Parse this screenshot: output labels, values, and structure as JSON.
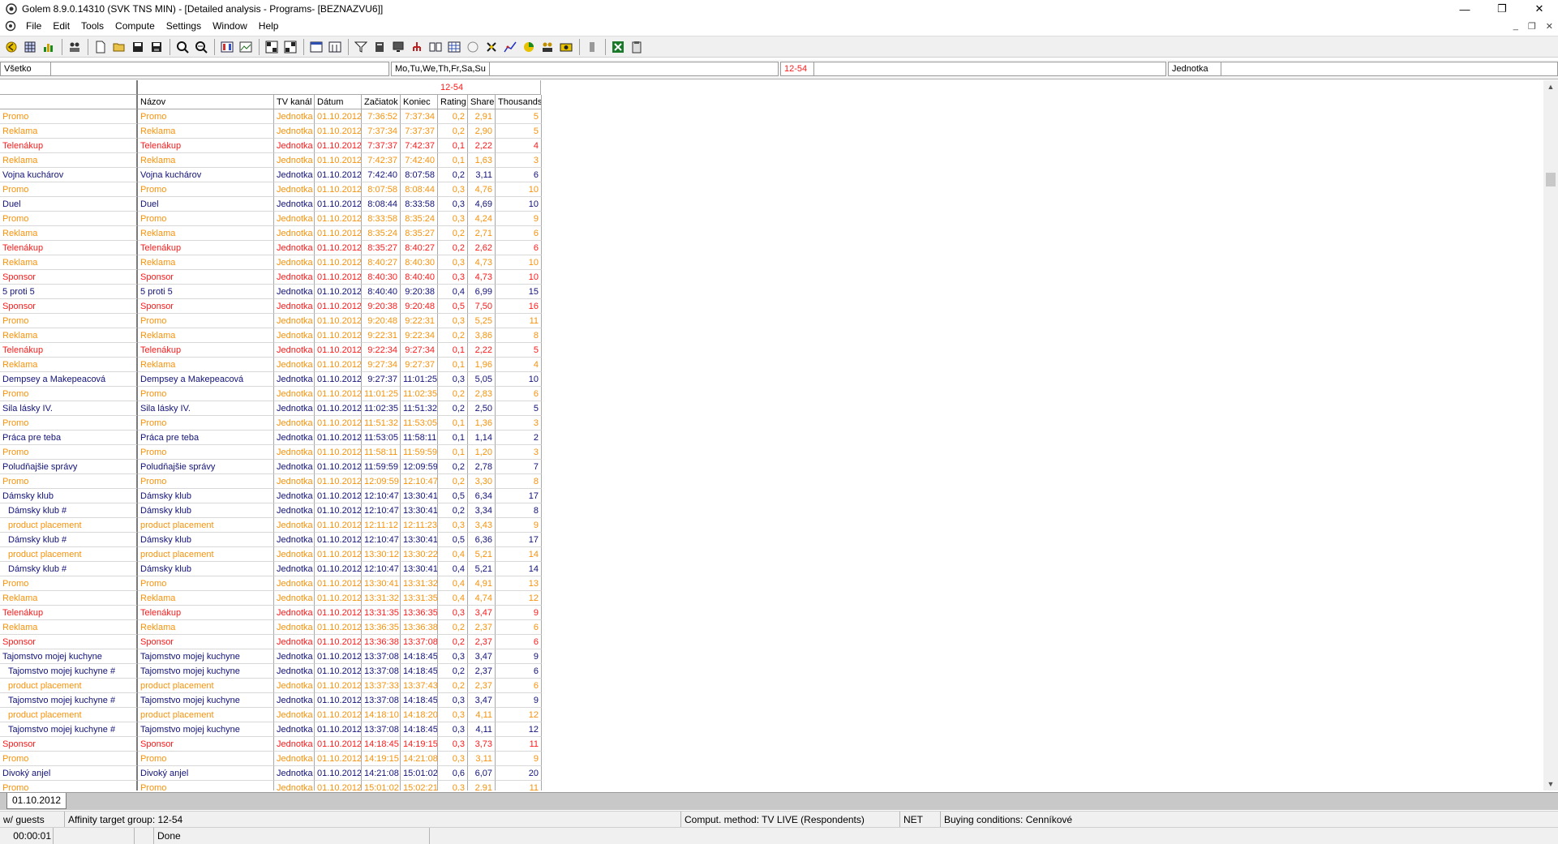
{
  "window": {
    "title": "Golem 8.9.0.14310 (SVK TNS MIN) - [Detailed analysis - Programs- [BEZNAZVU6]]",
    "minimize": "—",
    "restore": "❐",
    "close": "✕"
  },
  "menu": [
    "File",
    "Edit",
    "Tools",
    "Compute",
    "Settings",
    "Window",
    "Help"
  ],
  "mdi_controls": {
    "minimize": "_",
    "restore": "❐",
    "close": "✕"
  },
  "filterbar": {
    "f1": "Všetko",
    "f2": "Mo,Tu,We,Th,Fr,Sa,Su",
    "f3": "12-54",
    "f4": "Jednotka"
  },
  "table": {
    "target_group": "12-54",
    "headers": {
      "name": "Názov",
      "channel": "TV kanál",
      "date": "Dátum",
      "start": "Začiatok",
      "end": "Koniec",
      "rating": "Rating",
      "share": "Share",
      "thousands": "Thousands"
    },
    "rows": [
      {
        "first": "Promo",
        "name": "Promo",
        "ch": "Jednotka",
        "date": "01.10.2012",
        "start": "7:36:52",
        "end": "7:37:34",
        "rating": "0,2",
        "share": "2,91",
        "th": "5",
        "color": "orange",
        "indent": false
      },
      {
        "first": "Reklama",
        "name": "Reklama",
        "ch": "Jednotka",
        "date": "01.10.2012",
        "start": "7:37:34",
        "end": "7:37:37",
        "rating": "0,2",
        "share": "2,90",
        "th": "5",
        "color": "orange",
        "indent": false
      },
      {
        "first": "Telenákup",
        "name": "Telenákup",
        "ch": "Jednotka",
        "date": "01.10.2012",
        "start": "7:37:37",
        "end": "7:42:37",
        "rating": "0,1",
        "share": "2,22",
        "th": "4",
        "color": "red",
        "indent": false
      },
      {
        "first": "Reklama",
        "name": "Reklama",
        "ch": "Jednotka",
        "date": "01.10.2012",
        "start": "7:42:37",
        "end": "7:42:40",
        "rating": "0,1",
        "share": "1,63",
        "th": "3",
        "color": "orange",
        "indent": false
      },
      {
        "first": "Vojna kuchárov",
        "name": "Vojna kuchárov",
        "ch": "Jednotka",
        "date": "01.10.2012",
        "start": "7:42:40",
        "end": "8:07:58",
        "rating": "0,2",
        "share": "3,11",
        "th": "6",
        "color": "navy",
        "indent": false
      },
      {
        "first": "Promo",
        "name": "Promo",
        "ch": "Jednotka",
        "date": "01.10.2012",
        "start": "8:07:58",
        "end": "8:08:44",
        "rating": "0,3",
        "share": "4,76",
        "th": "10",
        "color": "orange",
        "indent": false
      },
      {
        "first": "Duel",
        "name": "Duel",
        "ch": "Jednotka",
        "date": "01.10.2012",
        "start": "8:08:44",
        "end": "8:33:58",
        "rating": "0,3",
        "share": "4,69",
        "th": "10",
        "color": "navy",
        "indent": false
      },
      {
        "first": "Promo",
        "name": "Promo",
        "ch": "Jednotka",
        "date": "01.10.2012",
        "start": "8:33:58",
        "end": "8:35:24",
        "rating": "0,3",
        "share": "4,24",
        "th": "9",
        "color": "orange",
        "indent": false
      },
      {
        "first": "Reklama",
        "name": "Reklama",
        "ch": "Jednotka",
        "date": "01.10.2012",
        "start": "8:35:24",
        "end": "8:35:27",
        "rating": "0,2",
        "share": "2,71",
        "th": "6",
        "color": "orange",
        "indent": false
      },
      {
        "first": "Telenákup",
        "name": "Telenákup",
        "ch": "Jednotka",
        "date": "01.10.2012",
        "start": "8:35:27",
        "end": "8:40:27",
        "rating": "0,2",
        "share": "2,62",
        "th": "6",
        "color": "red",
        "indent": false
      },
      {
        "first": "Reklama",
        "name": "Reklama",
        "ch": "Jednotka",
        "date": "01.10.2012",
        "start": "8:40:27",
        "end": "8:40:30",
        "rating": "0,3",
        "share": "4,73",
        "th": "10",
        "color": "orange",
        "indent": false
      },
      {
        "first": "Sponsor",
        "name": "Sponsor",
        "ch": "Jednotka",
        "date": "01.10.2012",
        "start": "8:40:30",
        "end": "8:40:40",
        "rating": "0,3",
        "share": "4,73",
        "th": "10",
        "color": "red",
        "indent": false
      },
      {
        "first": "5 proti 5",
        "name": "5 proti 5",
        "ch": "Jednotka",
        "date": "01.10.2012",
        "start": "8:40:40",
        "end": "9:20:38",
        "rating": "0,4",
        "share": "6,99",
        "th": "15",
        "color": "navy",
        "indent": false
      },
      {
        "first": "Sponsor",
        "name": "Sponsor",
        "ch": "Jednotka",
        "date": "01.10.2012",
        "start": "9:20:38",
        "end": "9:20:48",
        "rating": "0,5",
        "share": "7,50",
        "th": "16",
        "color": "red",
        "indent": false
      },
      {
        "first": "Promo",
        "name": "Promo",
        "ch": "Jednotka",
        "date": "01.10.2012",
        "start": "9:20:48",
        "end": "9:22:31",
        "rating": "0,3",
        "share": "5,25",
        "th": "11",
        "color": "orange",
        "indent": false
      },
      {
        "first": "Reklama",
        "name": "Reklama",
        "ch": "Jednotka",
        "date": "01.10.2012",
        "start": "9:22:31",
        "end": "9:22:34",
        "rating": "0,2",
        "share": "3,86",
        "th": "8",
        "color": "orange",
        "indent": false
      },
      {
        "first": "Telenákup",
        "name": "Telenákup",
        "ch": "Jednotka",
        "date": "01.10.2012",
        "start": "9:22:34",
        "end": "9:27:34",
        "rating": "0,1",
        "share": "2,22",
        "th": "5",
        "color": "red",
        "indent": false
      },
      {
        "first": "Reklama",
        "name": "Reklama",
        "ch": "Jednotka",
        "date": "01.10.2012",
        "start": "9:27:34",
        "end": "9:27:37",
        "rating": "0,1",
        "share": "1,96",
        "th": "4",
        "color": "orange",
        "indent": false
      },
      {
        "first": "Dempsey a Makepeacová",
        "name": "Dempsey a Makepeacová",
        "ch": "Jednotka",
        "date": "01.10.2012",
        "start": "9:27:37",
        "end": "11:01:25",
        "rating": "0,3",
        "share": "5,05",
        "th": "10",
        "color": "navy",
        "indent": false
      },
      {
        "first": "Promo",
        "name": "Promo",
        "ch": "Jednotka",
        "date": "01.10.2012",
        "start": "11:01:25",
        "end": "11:02:35",
        "rating": "0,2",
        "share": "2,83",
        "th": "6",
        "color": "orange",
        "indent": false
      },
      {
        "first": "Sila lásky IV.",
        "name": "Sila lásky IV.",
        "ch": "Jednotka",
        "date": "01.10.2012",
        "start": "11:02:35",
        "end": "11:51:32",
        "rating": "0,2",
        "share": "2,50",
        "th": "5",
        "color": "navy",
        "indent": false
      },
      {
        "first": "Promo",
        "name": "Promo",
        "ch": "Jednotka",
        "date": "01.10.2012",
        "start": "11:51:32",
        "end": "11:53:05",
        "rating": "0,1",
        "share": "1,36",
        "th": "3",
        "color": "orange",
        "indent": false
      },
      {
        "first": "Práca pre teba",
        "name": "Práca pre teba",
        "ch": "Jednotka",
        "date": "01.10.2012",
        "start": "11:53:05",
        "end": "11:58:11",
        "rating": "0,1",
        "share": "1,14",
        "th": "2",
        "color": "navy",
        "indent": false
      },
      {
        "first": "Promo",
        "name": "Promo",
        "ch": "Jednotka",
        "date": "01.10.2012",
        "start": "11:58:11",
        "end": "11:59:59",
        "rating": "0,1",
        "share": "1,20",
        "th": "3",
        "color": "orange",
        "indent": false
      },
      {
        "first": "Poludňajšie správy",
        "name": "Poludňajšie správy",
        "ch": "Jednotka",
        "date": "01.10.2012",
        "start": "11:59:59",
        "end": "12:09:59",
        "rating": "0,2",
        "share": "2,78",
        "th": "7",
        "color": "navy",
        "indent": false
      },
      {
        "first": "Promo",
        "name": "Promo",
        "ch": "Jednotka",
        "date": "01.10.2012",
        "start": "12:09:59",
        "end": "12:10:47",
        "rating": "0,2",
        "share": "3,30",
        "th": "8",
        "color": "orange",
        "indent": false
      },
      {
        "first": "Dámsky klub",
        "name": "Dámsky klub",
        "ch": "Jednotka",
        "date": "01.10.2012",
        "start": "12:10:47",
        "end": "13:30:41",
        "rating": "0,5",
        "share": "6,34",
        "th": "17",
        "color": "navy",
        "indent": false
      },
      {
        "first": "Dámsky klub #",
        "name": "Dámsky klub",
        "ch": "Jednotka",
        "date": "01.10.2012",
        "start": "12:10:47",
        "end": "13:30:41",
        "rating": "0,2",
        "share": "3,34",
        "th": "8",
        "color": "navy",
        "indent": true
      },
      {
        "first": "product placement",
        "name": "product placement",
        "ch": "Jednotka",
        "date": "01.10.2012",
        "start": "12:11:12",
        "end": "12:11:23",
        "rating": "0,3",
        "share": "3,43",
        "th": "9",
        "color": "orange",
        "indent": true
      },
      {
        "first": "Dámsky klub #",
        "name": "Dámsky klub",
        "ch": "Jednotka",
        "date": "01.10.2012",
        "start": "12:10:47",
        "end": "13:30:41",
        "rating": "0,5",
        "share": "6,36",
        "th": "17",
        "color": "navy",
        "indent": true
      },
      {
        "first": "product placement",
        "name": "product placement",
        "ch": "Jednotka",
        "date": "01.10.2012",
        "start": "13:30:12",
        "end": "13:30:22",
        "rating": "0,4",
        "share": "5,21",
        "th": "14",
        "color": "orange",
        "indent": true
      },
      {
        "first": "Dámsky klub #",
        "name": "Dámsky klub",
        "ch": "Jednotka",
        "date": "01.10.2012",
        "start": "12:10:47",
        "end": "13:30:41",
        "rating": "0,4",
        "share": "5,21",
        "th": "14",
        "color": "navy",
        "indent": true
      },
      {
        "first": "Promo",
        "name": "Promo",
        "ch": "Jednotka",
        "date": "01.10.2012",
        "start": "13:30:41",
        "end": "13:31:32",
        "rating": "0,4",
        "share": "4,91",
        "th": "13",
        "color": "orange",
        "indent": false
      },
      {
        "first": "Reklama",
        "name": "Reklama",
        "ch": "Jednotka",
        "date": "01.10.2012",
        "start": "13:31:32",
        "end": "13:31:35",
        "rating": "0,4",
        "share": "4,74",
        "th": "12",
        "color": "orange",
        "indent": false
      },
      {
        "first": "Telenákup",
        "name": "Telenákup",
        "ch": "Jednotka",
        "date": "01.10.2012",
        "start": "13:31:35",
        "end": "13:36:35",
        "rating": "0,3",
        "share": "3,47",
        "th": "9",
        "color": "red",
        "indent": false
      },
      {
        "first": "Reklama",
        "name": "Reklama",
        "ch": "Jednotka",
        "date": "01.10.2012",
        "start": "13:36:35",
        "end": "13:36:38",
        "rating": "0,2",
        "share": "2,37",
        "th": "6",
        "color": "orange",
        "indent": false
      },
      {
        "first": "Sponsor",
        "name": "Sponsor",
        "ch": "Jednotka",
        "date": "01.10.2012",
        "start": "13:36:38",
        "end": "13:37:08",
        "rating": "0,2",
        "share": "2,37",
        "th": "6",
        "color": "red",
        "indent": false
      },
      {
        "first": "Tajomstvo mojej kuchyne",
        "name": "Tajomstvo mojej kuchyne",
        "ch": "Jednotka",
        "date": "01.10.2012",
        "start": "13:37:08",
        "end": "14:18:45",
        "rating": "0,3",
        "share": "3,47",
        "th": "9",
        "color": "navy",
        "indent": false
      },
      {
        "first": "Tajomstvo mojej kuchyne #",
        "name": "Tajomstvo mojej kuchyne",
        "ch": "Jednotka",
        "date": "01.10.2012",
        "start": "13:37:08",
        "end": "14:18:45",
        "rating": "0,2",
        "share": "2,37",
        "th": "6",
        "color": "navy",
        "indent": true
      },
      {
        "first": "product placement",
        "name": "product placement",
        "ch": "Jednotka",
        "date": "01.10.2012",
        "start": "13:37:33",
        "end": "13:37:43",
        "rating": "0,2",
        "share": "2,37",
        "th": "6",
        "color": "orange",
        "indent": true
      },
      {
        "first": "Tajomstvo mojej kuchyne #",
        "name": "Tajomstvo mojej kuchyne",
        "ch": "Jednotka",
        "date": "01.10.2012",
        "start": "13:37:08",
        "end": "14:18:45",
        "rating": "0,3",
        "share": "3,47",
        "th": "9",
        "color": "navy",
        "indent": true
      },
      {
        "first": "product placement",
        "name": "product placement",
        "ch": "Jednotka",
        "date": "01.10.2012",
        "start": "14:18:10",
        "end": "14:18:20",
        "rating": "0,3",
        "share": "4,11",
        "th": "12",
        "color": "orange",
        "indent": true
      },
      {
        "first": "Tajomstvo mojej kuchyne #",
        "name": "Tajomstvo mojej kuchyne",
        "ch": "Jednotka",
        "date": "01.10.2012",
        "start": "13:37:08",
        "end": "14:18:45",
        "rating": "0,3",
        "share": "4,11",
        "th": "12",
        "color": "navy",
        "indent": true
      },
      {
        "first": "Sponsor",
        "name": "Sponsor",
        "ch": "Jednotka",
        "date": "01.10.2012",
        "start": "14:18:45",
        "end": "14:19:15",
        "rating": "0,3",
        "share": "3,73",
        "th": "11",
        "color": "red",
        "indent": false
      },
      {
        "first": "Promo",
        "name": "Promo",
        "ch": "Jednotka",
        "date": "01.10.2012",
        "start": "14:19:15",
        "end": "14:21:08",
        "rating": "0,3",
        "share": "3,11",
        "th": "9",
        "color": "orange",
        "indent": false
      },
      {
        "first": "Divoký anjel",
        "name": "Divoký anjel",
        "ch": "Jednotka",
        "date": "01.10.2012",
        "start": "14:21:08",
        "end": "15:01:02",
        "rating": "0,6",
        "share": "6,07",
        "th": "20",
        "color": "navy",
        "indent": false
      },
      {
        "first": "Promo",
        "name": "Promo",
        "ch": "Jednotka",
        "date": "01.10.2012",
        "start": "15:01:02",
        "end": "15:02:21",
        "rating": "0,3",
        "share": "2,91",
        "th": "11",
        "color": "orange",
        "indent": false
      }
    ]
  },
  "colors": {
    "orange": "#f7920b",
    "red": "#ff1a1a",
    "navy": "#12127a"
  },
  "sheet_tab": "01.10.2012",
  "status": {
    "guests": "w/ guests",
    "affinity": "Affinity target group: 12-54",
    "method": "Comput. method: TV LIVE (Respondents)",
    "net": "NET",
    "buying": "Buying conditions: Cenníkové",
    "time": "00:00:01",
    "done": "Done"
  },
  "toolbar_icons": [
    "back-icon",
    "grid-icon",
    "chart-icon",
    "people-icon",
    "new-file-icon",
    "open-folder-icon",
    "save-icon",
    "save-as-icon",
    "zoom-in-icon",
    "zoom-out-icon",
    "columns-icon",
    "picture-icon",
    "table-icon",
    "table2-icon",
    "calendar-icon",
    "calendar2-icon",
    "filter-icon",
    "bookmark-icon",
    "monitor-icon",
    "tree-icon",
    "book-icon",
    "spreadsheet-icon",
    "circle-icon",
    "cross-icon",
    "line-chart-icon",
    "pie-icon",
    "group-icon",
    "camera-icon",
    "pause-icon",
    "excel-icon",
    "clipboard-icon"
  ]
}
